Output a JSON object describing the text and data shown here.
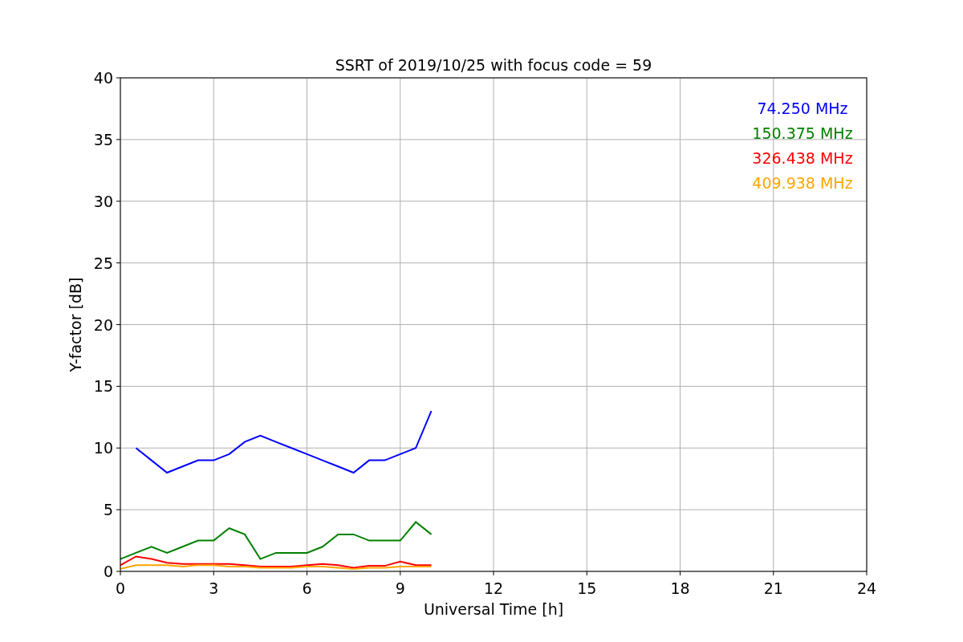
{
  "figure": {
    "chart_data": {
      "type": "line",
      "title": "SSRT of 2019/10/25 with focus code = 59",
      "xlabel": "Universal Time [h]",
      "ylabel": "Y-factor [dB]",
      "x": [
        0,
        0.5,
        1,
        1.5,
        2,
        2.5,
        3,
        3.5,
        4,
        4.5,
        5,
        5.5,
        6,
        6.5,
        7,
        7.5,
        8,
        8.5,
        9,
        9.5,
        10
      ],
      "series": [
        {
          "name": "74.250 MHz",
          "color": "#0000ff",
          "values": [
            null,
            10,
            9,
            8,
            8.5,
            9,
            9,
            9.5,
            10.5,
            11,
            10.5,
            10,
            9.5,
            9,
            8.5,
            8,
            9,
            9,
            9.5,
            10,
            13
          ]
        },
        {
          "name": "150.375 MHz",
          "color": "#008000",
          "values": [
            1,
            1.5,
            2,
            1.5,
            2,
            2.5,
            2.5,
            3.5,
            3,
            1,
            1.5,
            1.5,
            1.5,
            2,
            3,
            3,
            2.5,
            2.5,
            2.5,
            4,
            3
          ]
        },
        {
          "name": "326.438 MHz",
          "color": "#ff0000",
          "values": [
            0.5,
            1.2,
            1,
            0.7,
            0.6,
            0.6,
            0.6,
            0.6,
            0.5,
            0.4,
            0.4,
            0.4,
            0.5,
            0.6,
            0.5,
            0.3,
            0.45,
            0.45,
            0.8,
            0.5,
            0.5
          ]
        },
        {
          "name": "409.938 MHz",
          "color": "#ffa500",
          "values": [
            0.2,
            0.5,
            0.5,
            0.5,
            0.4,
            0.5,
            0.5,
            0.4,
            0.4,
            0.3,
            0.3,
            0.3,
            0.4,
            0.4,
            0.3,
            0.2,
            0.3,
            0.3,
            0.4,
            0.4,
            0.4
          ]
        }
      ],
      "xlim": [
        0,
        24
      ],
      "ylim": [
        0,
        40
      ],
      "xticks": [
        0,
        3,
        6,
        9,
        12,
        15,
        18,
        21,
        24
      ],
      "yticks": [
        0,
        5,
        10,
        15,
        20,
        25,
        30,
        35,
        40
      ],
      "grid": true
    }
  }
}
